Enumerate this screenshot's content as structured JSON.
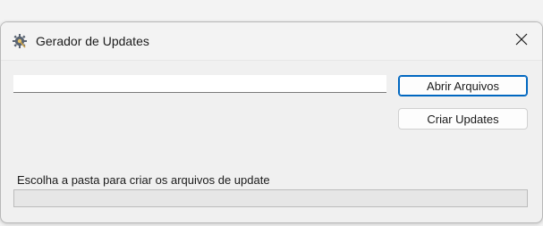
{
  "window": {
    "title": "Gerador de Updates",
    "app_icon": "gear-wrench-icon",
    "close_icon": "close-icon"
  },
  "form": {
    "path_input_value": "",
    "path_input_placeholder": "",
    "open_files_label": "Abrir Arquivos",
    "create_updates_label": "Criar Updates"
  },
  "status": {
    "message": "Escolha a pasta para criar os arquivos de update",
    "progress": 0
  },
  "colors": {
    "accent": "#0067c0",
    "progress_fill": "#06b025"
  }
}
